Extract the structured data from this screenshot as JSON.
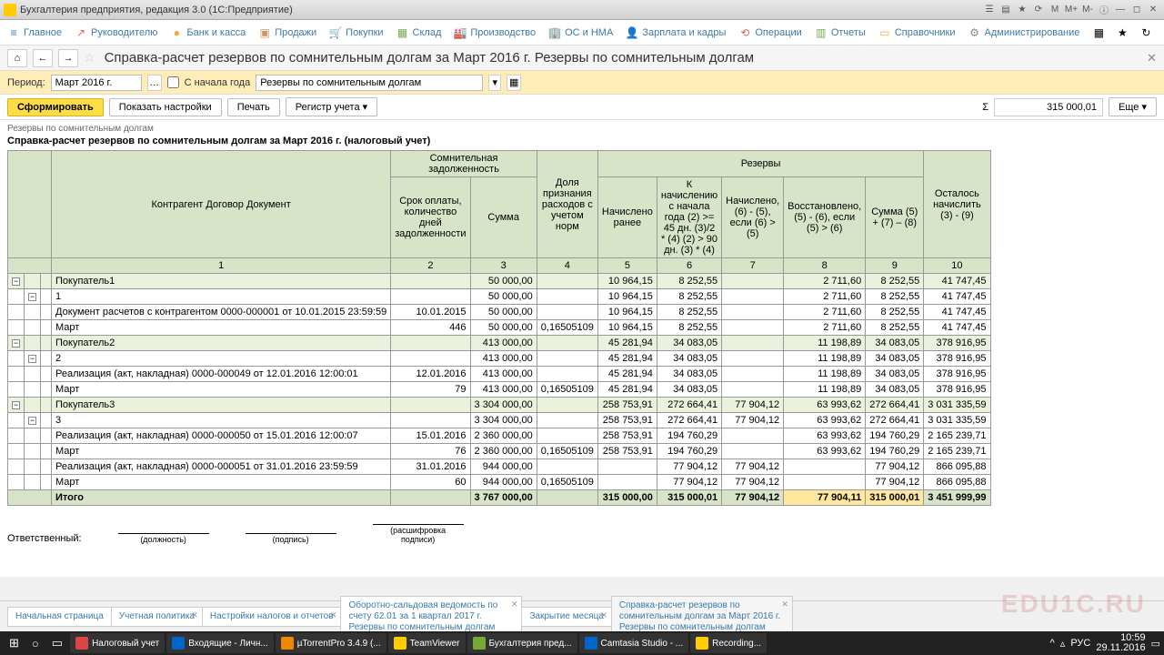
{
  "window": {
    "title": "Бухгалтерия предприятия, редакция 3.0 (1С:Предприятие)"
  },
  "menu": {
    "items": [
      "Главное",
      "Руководителю",
      "Банк и касса",
      "Продажи",
      "Покупки",
      "Склад",
      "Производство",
      "ОС и НМА",
      "Зарплата и кадры",
      "Операции",
      "Отчеты",
      "Справочники",
      "Администрирование"
    ]
  },
  "page": {
    "title": "Справка-расчет резервов по сомнительным долгам за Март 2016 г. Резервы по сомнительным долгам"
  },
  "filter": {
    "period_label": "Период:",
    "period_value": "Март 2016 г.",
    "from_start_label": "С начала года",
    "type_value": "Резервы по сомнительным долгам"
  },
  "toolbar": {
    "generate": "Сформировать",
    "settings": "Показать настройки",
    "print": "Печать",
    "register": "Регистр учета",
    "more": "Еще",
    "sigma": "Σ",
    "sum": "315 000,01"
  },
  "report": {
    "caption": "Резервы по сомнительным долгам",
    "title": "Справка-расчет резервов по сомнительным долгам за Март 2016 г. (налоговый учет)"
  },
  "headers": {
    "col1": "Контрагент\nДоговор\nДокумент",
    "grp_debt": "Сомнительная задолженность",
    "col2": "Срок оплаты, количество дней задолженности",
    "col3": "Сумма",
    "col4": "Доля признания расходов с учетом норм",
    "grp_res": "Резервы",
    "col5": "Начислено ранее",
    "col6": "К начислению с начала года (2) >= 45 дн. (3)/2 * (4) (2) > 90 дн. (3) * (4)",
    "col7": "Начислено, (6) - (5), если (6) > (5)",
    "col8": "Восстановлено, (5) - (6), если (5) > (6)",
    "col9": "Сумма (5) + (7) – (8)",
    "col10": "Осталось начислить (3) - (9)"
  },
  "colnums": [
    "1",
    "2",
    "3",
    "4",
    "5",
    "6",
    "7",
    "8",
    "9",
    "10"
  ],
  "rows": [
    {
      "cls": "group",
      "c1": "Покупатель1",
      "c3": "50 000,00",
      "c5": "10 964,15",
      "c6": "8 252,55",
      "c8": "2 711,60",
      "c9": "8 252,55",
      "c10": "41 747,45"
    },
    {
      "cls": "",
      "c1": "1",
      "c3": "50 000,00",
      "c5": "10 964,15",
      "c6": "8 252,55",
      "c8": "2 711,60",
      "c9": "8 252,55",
      "c10": "41 747,45"
    },
    {
      "cls": "",
      "c1": "Документ расчетов с контрагентом 0000-000001 от 10.01.2015 23:59:59",
      "c2": "10.01.2015",
      "c3": "50 000,00",
      "c5": "10 964,15",
      "c6": "8 252,55",
      "c8": "2 711,60",
      "c9": "8 252,55",
      "c10": "41 747,45"
    },
    {
      "cls": "",
      "c1": "Март",
      "c2": "446",
      "c3": "50 000,00",
      "c4": "0,16505109",
      "c5": "10 964,15",
      "c6": "8 252,55",
      "c8": "2 711,60",
      "c9": "8 252,55",
      "c10": "41 747,45"
    },
    {
      "cls": "group",
      "c1": "Покупатель2",
      "c3": "413 000,00",
      "c5": "45 281,94",
      "c6": "34 083,05",
      "c8": "11 198,89",
      "c9": "34 083,05",
      "c10": "378 916,95"
    },
    {
      "cls": "",
      "c1": "2",
      "c3": "413 000,00",
      "c5": "45 281,94",
      "c6": "34 083,05",
      "c8": "11 198,89",
      "c9": "34 083,05",
      "c10": "378 916,95"
    },
    {
      "cls": "",
      "c1": "Реализация (акт, накладная) 0000-000049 от 12.01.2016 12:00:01",
      "c2": "12.01.2016",
      "c3": "413 000,00",
      "c5": "45 281,94",
      "c6": "34 083,05",
      "c8": "11 198,89",
      "c9": "34 083,05",
      "c10": "378 916,95"
    },
    {
      "cls": "",
      "c1": "Март",
      "c2": "79",
      "c3": "413 000,00",
      "c4": "0,16505109",
      "c5": "45 281,94",
      "c6": "34 083,05",
      "c8": "11 198,89",
      "c9": "34 083,05",
      "c10": "378 916,95"
    },
    {
      "cls": "group",
      "c1": "Покупатель3",
      "c3": "3 304 000,00",
      "c5": "258 753,91",
      "c6": "272 664,41",
      "c7": "77 904,12",
      "c8": "63 993,62",
      "c9": "272 664,41",
      "c10": "3 031 335,59"
    },
    {
      "cls": "",
      "c1": "3",
      "c3": "3 304 000,00",
      "c5": "258 753,91",
      "c6": "272 664,41",
      "c7": "77 904,12",
      "c8": "63 993,62",
      "c9": "272 664,41",
      "c10": "3 031 335,59"
    },
    {
      "cls": "",
      "c1": "Реализация (акт, накладная) 0000-000050 от 15.01.2016 12:00:07",
      "c2": "15.01.2016",
      "c3": "2 360 000,00",
      "c5": "258 753,91",
      "c6": "194 760,29",
      "c8": "63 993,62",
      "c9": "194 760,29",
      "c10": "2 165 239,71"
    },
    {
      "cls": "",
      "c1": "Март",
      "c2": "76",
      "c3": "2 360 000,00",
      "c4": "0,16505109",
      "c5": "258 753,91",
      "c6": "194 760,29",
      "c8": "63 993,62",
      "c9": "194 760,29",
      "c10": "2 165 239,71"
    },
    {
      "cls": "",
      "c1": "Реализация (акт, накладная) 0000-000051 от 31.01.2016 23:59:59",
      "c2": "31.01.2016",
      "c3": "944 000,00",
      "c6": "77 904,12",
      "c7": "77 904,12",
      "c9": "77 904,12",
      "c10": "866 095,88"
    },
    {
      "cls": "",
      "c1": "Март",
      "c2": "60",
      "c3": "944 000,00",
      "c4": "0,16505109",
      "c6": "77 904,12",
      "c7": "77 904,12",
      "c9": "77 904,12",
      "c10": "866 095,88"
    }
  ],
  "total": {
    "label": "Итого",
    "c3": "3 767 000,00",
    "c5": "315 000,00",
    "c6": "315 000,01",
    "c7": "77 904,12",
    "c8": "77 904,11",
    "c9": "315 000,01",
    "c10": "3 451 999,99"
  },
  "sign": {
    "resp": "Ответственный:",
    "pos": "(должность)",
    "sig": "(подпись)",
    "dec": "(расшифровка подписи)"
  },
  "tabs": [
    "Начальная страница",
    "Учетная политика",
    "Настройки налогов и отчетов",
    "Оборотно-сальдовая ведомость по счету 62.01 за 1 квартал 2017 г. Резервы по сомнительным долгам",
    "Закрытие месяца",
    "Справка-расчет резервов по сомнительным долгам за Март 2016 г. Резервы по сомнительным долгам"
  ],
  "taskbar": [
    "Налоговый учет",
    "Входящие - Личн...",
    "µTorrentPro 3.4.9 (...",
    "TeamViewer",
    "Бухгалтерия пред...",
    "Camtasia Studio - ...",
    "Recording..."
  ],
  "tray": {
    "lang": "РУС",
    "time": "10:59",
    "date": "29.11.2016"
  },
  "watermark": "EDU1C.RU"
}
